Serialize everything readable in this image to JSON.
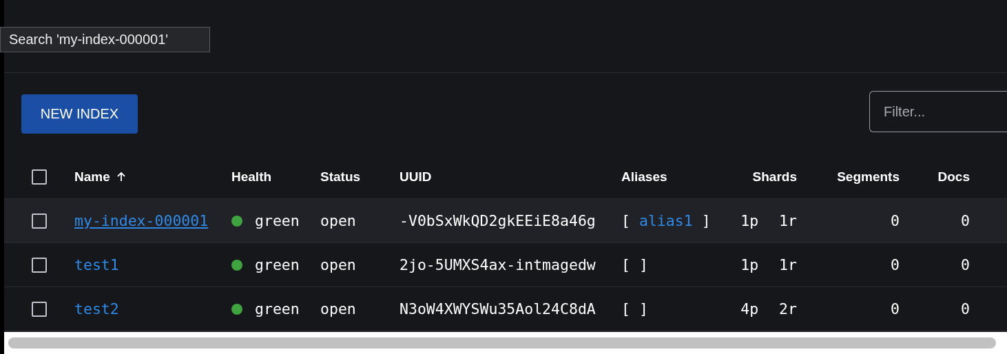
{
  "tooltip": "Search 'my-index-000001'",
  "new_index_button": "NEW INDEX",
  "filter": {
    "placeholder": "Filter..."
  },
  "table": {
    "select_all_checked": false,
    "columns": [
      {
        "label": "Name",
        "sorted": true
      },
      {
        "label": "Health",
        "sorted": false
      },
      {
        "label": "Status",
        "sorted": false
      },
      {
        "label": "UUID",
        "sorted": false
      },
      {
        "label": "Aliases",
        "sorted": false
      },
      {
        "label": "Shards",
        "sorted": false
      },
      {
        "label": "Segments",
        "sorted": false
      },
      {
        "label": "Docs",
        "sorted": false
      }
    ],
    "rows": [
      {
        "checked": false,
        "hovered": true,
        "name": "my-index-000001",
        "name_underlined": true,
        "health": "green",
        "color": "#3fa33f",
        "status": "open",
        "uuid": "-V0bSxWkQD2gkEEiE8a46g",
        "aliases": [
          {
            "kind": "plain",
            "text": "["
          },
          {
            "kind": "link",
            "text": "alias1"
          },
          {
            "kind": "plain",
            "text": "]"
          }
        ],
        "primaries": "1p",
        "replicas": "1r",
        "segments": "0",
        "docs": "0"
      },
      {
        "checked": false,
        "hovered": false,
        "name": "test1",
        "name_underlined": false,
        "health": "green",
        "color": "#3fa33f",
        "status": "open",
        "uuid": "2jo-5UMXS4ax-intmagedw",
        "aliases": [
          {
            "kind": "plain",
            "text": "[ ]"
          }
        ],
        "primaries": "1p",
        "replicas": "1r",
        "segments": "0",
        "docs": "0"
      },
      {
        "checked": false,
        "hovered": false,
        "name": "test2",
        "name_underlined": false,
        "health": "green",
        "color": "#3fa33f",
        "status": "open",
        "uuid": "N3oW4XWYSWu35Aol24C8dA",
        "aliases": [
          {
            "kind": "plain",
            "text": "[ ]"
          }
        ],
        "primaries": "4p",
        "replicas": "2r",
        "segments": "0",
        "docs": "0"
      }
    ]
  }
}
